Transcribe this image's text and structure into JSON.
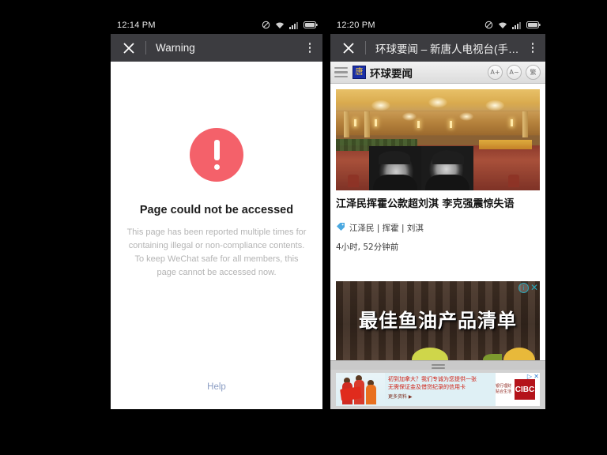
{
  "left_phone": {
    "status_bar": {
      "clock": "12:14 PM",
      "icons": [
        "mute-icon",
        "wifi-icon",
        "signal-icon",
        "battery-icon"
      ]
    },
    "app_bar": {
      "close_label": "✕",
      "title": "Warning",
      "overflow_label": "⋮"
    },
    "warning": {
      "icon": "exclamation-circle-icon",
      "icon_color": "#f4616a",
      "title": "Page could not be accessed",
      "body": "This page has been reported multiple times for containing illegal or non-compliance contents. To keep WeChat safe for all members, this page cannot be accessed now.",
      "help_label": "Help",
      "help_color": "#8b9dc3"
    }
  },
  "right_phone": {
    "status_bar": {
      "clock": "12:20 PM",
      "icons": [
        "mute-icon",
        "wifi-icon",
        "signal-icon",
        "battery-icon"
      ]
    },
    "app_bar": {
      "close_label": "✕",
      "title": "环球要闻 – 新唐人电视台(手…",
      "overflow_label": "⋮"
    },
    "site_bar": {
      "menu_icon": "hamburger-icon",
      "logo_glyph": "唐",
      "site_name": "环球要闻",
      "buttons": [
        {
          "name": "font-increase",
          "label": "A+"
        },
        {
          "name": "font-decrease",
          "label": "A−"
        },
        {
          "name": "traditional-chinese",
          "label": "繁"
        }
      ]
    },
    "article": {
      "image_alt": "ornate-banquet-hall-photo",
      "headline": "江泽民挥霍公款超刘淇 李克强震惊失语",
      "tag_icon": "tag-icon",
      "tags": "江泽民 | 挥霍 | 刘淇",
      "timestamp": "4小时, 52分钟前"
    },
    "inline_ad": {
      "headline": "最佳鱼油产品清单",
      "adchoices_info": "ⓘ",
      "adchoices_close": "✕"
    },
    "drag_handle": "resize-handle",
    "bottom_ad": {
      "line1": "初到加拿大？我们专诚为您提供一张",
      "line2": "无需保证金及借贷纪录的信用卡",
      "cta": "更多资料 ▶",
      "side_text": "银行理财 贴合生活",
      "brand": "CIBC",
      "adchoices": "▷ ✕"
    }
  }
}
